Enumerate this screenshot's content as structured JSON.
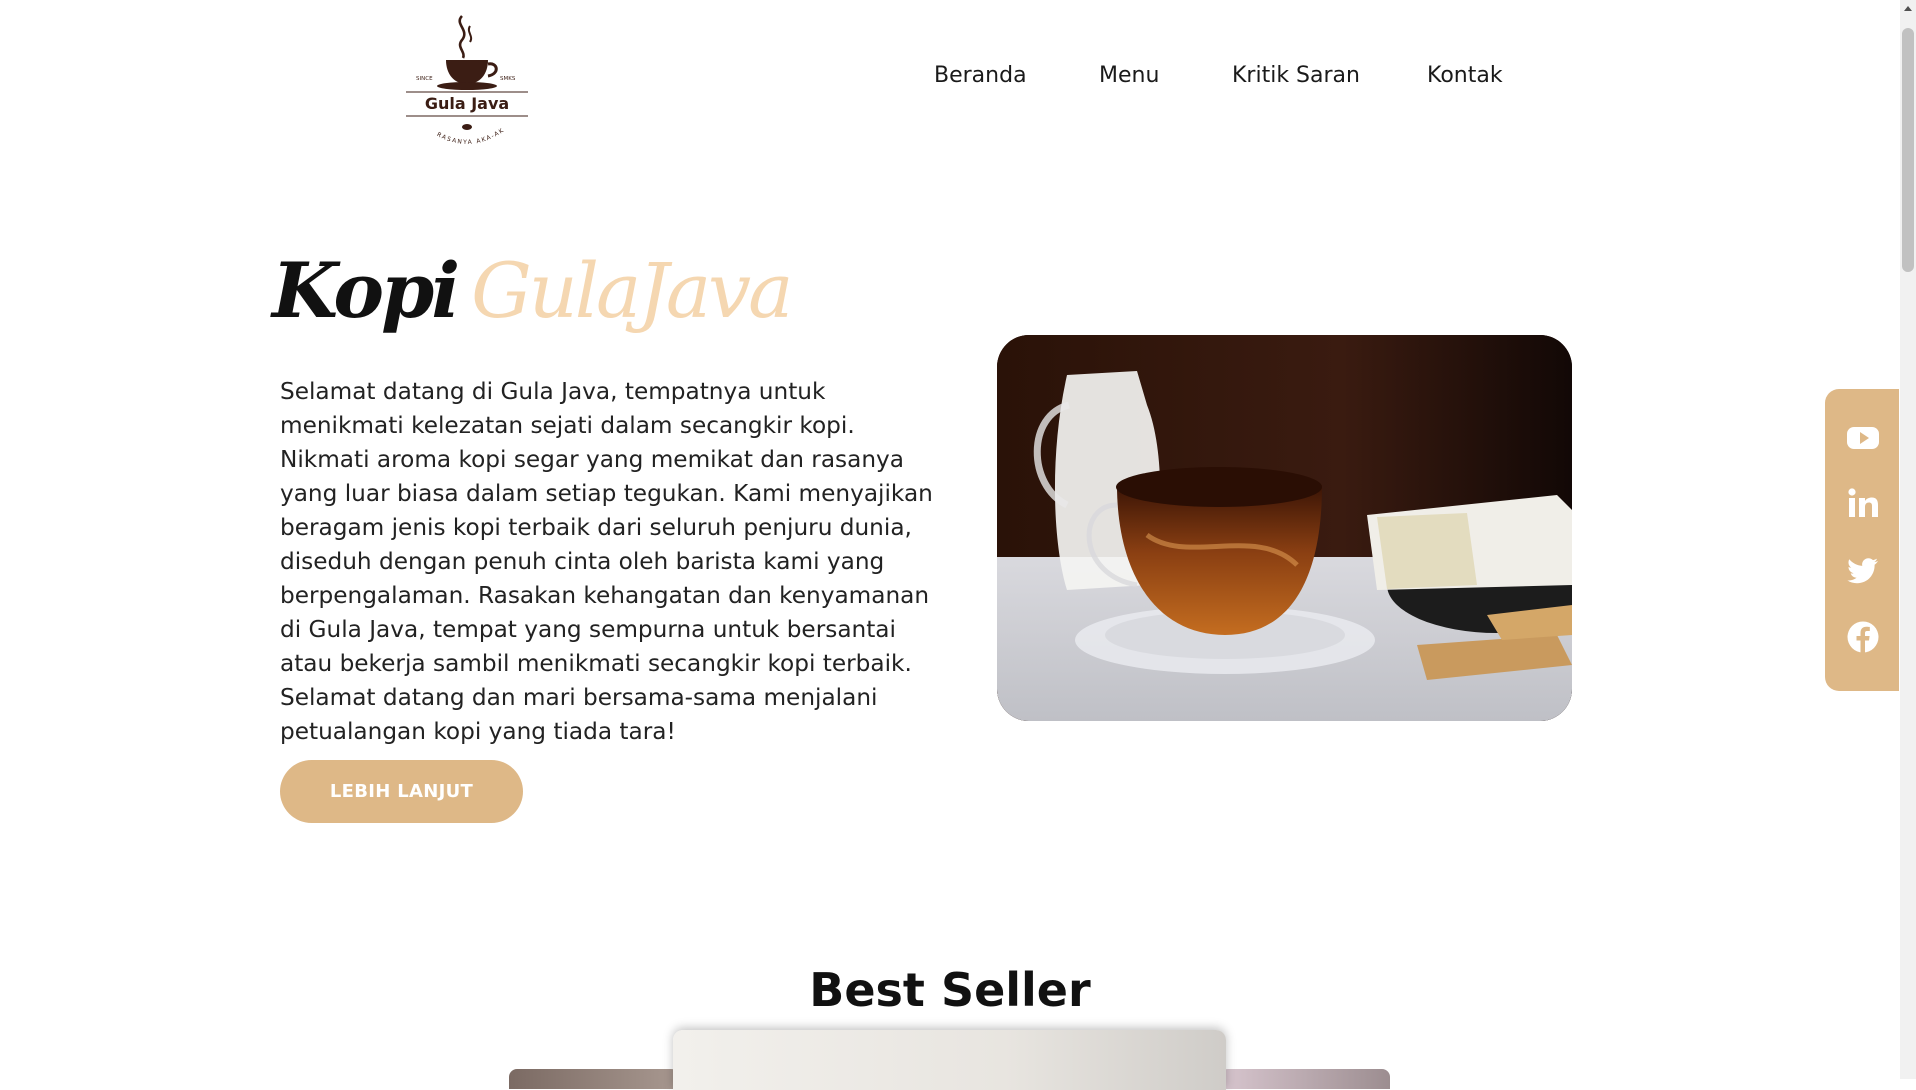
{
  "header": {
    "logo": {
      "brand": "Gula Java",
      "since_left": "SINCE",
      "since_right": "SMKS",
      "tagline": "RASANYA AKA-AKA"
    },
    "nav": [
      {
        "label": "Beranda"
      },
      {
        "label": "Menu"
      },
      {
        "label": "Kritik Saran"
      },
      {
        "label": "Kontak"
      }
    ]
  },
  "hero": {
    "title_word1": "Kopi",
    "title_word2": "GulaJava",
    "description": "Selamat datang di Gula Java, tempatnya untuk menikmati kelezatan sejati dalam secangkir kopi. Nikmati aroma kopi segar yang memikat dan rasanya yang luar biasa dalam setiap tegukan. Kami menyajikan beragam jenis kopi terbaik dari seluruh penjuru dunia, diseduh dengan penuh cinta oleh barista kami yang berpengalaman. Rasakan kehangatan dan kenyamanan di Gula Java, tempat yang sempurna untuk bersantai atau bekerja sambil menikmati secangkir kopi terbaik. Selamat datang dan mari bersama-sama menjalani petualangan kopi yang tiada tara!",
    "cta_label": "LEBIH LANJUT"
  },
  "social": [
    {
      "icon": "youtube-icon"
    },
    {
      "icon": "linkedin-icon"
    },
    {
      "icon": "twitter-icon"
    },
    {
      "icon": "facebook-icon"
    }
  ],
  "best_seller": {
    "title": "Best Seller"
  },
  "colors": {
    "accent": "#deb887",
    "title_accent": "#f5d7b1",
    "logo_brown": "#3b1d14",
    "text": "#1a1a1a"
  }
}
